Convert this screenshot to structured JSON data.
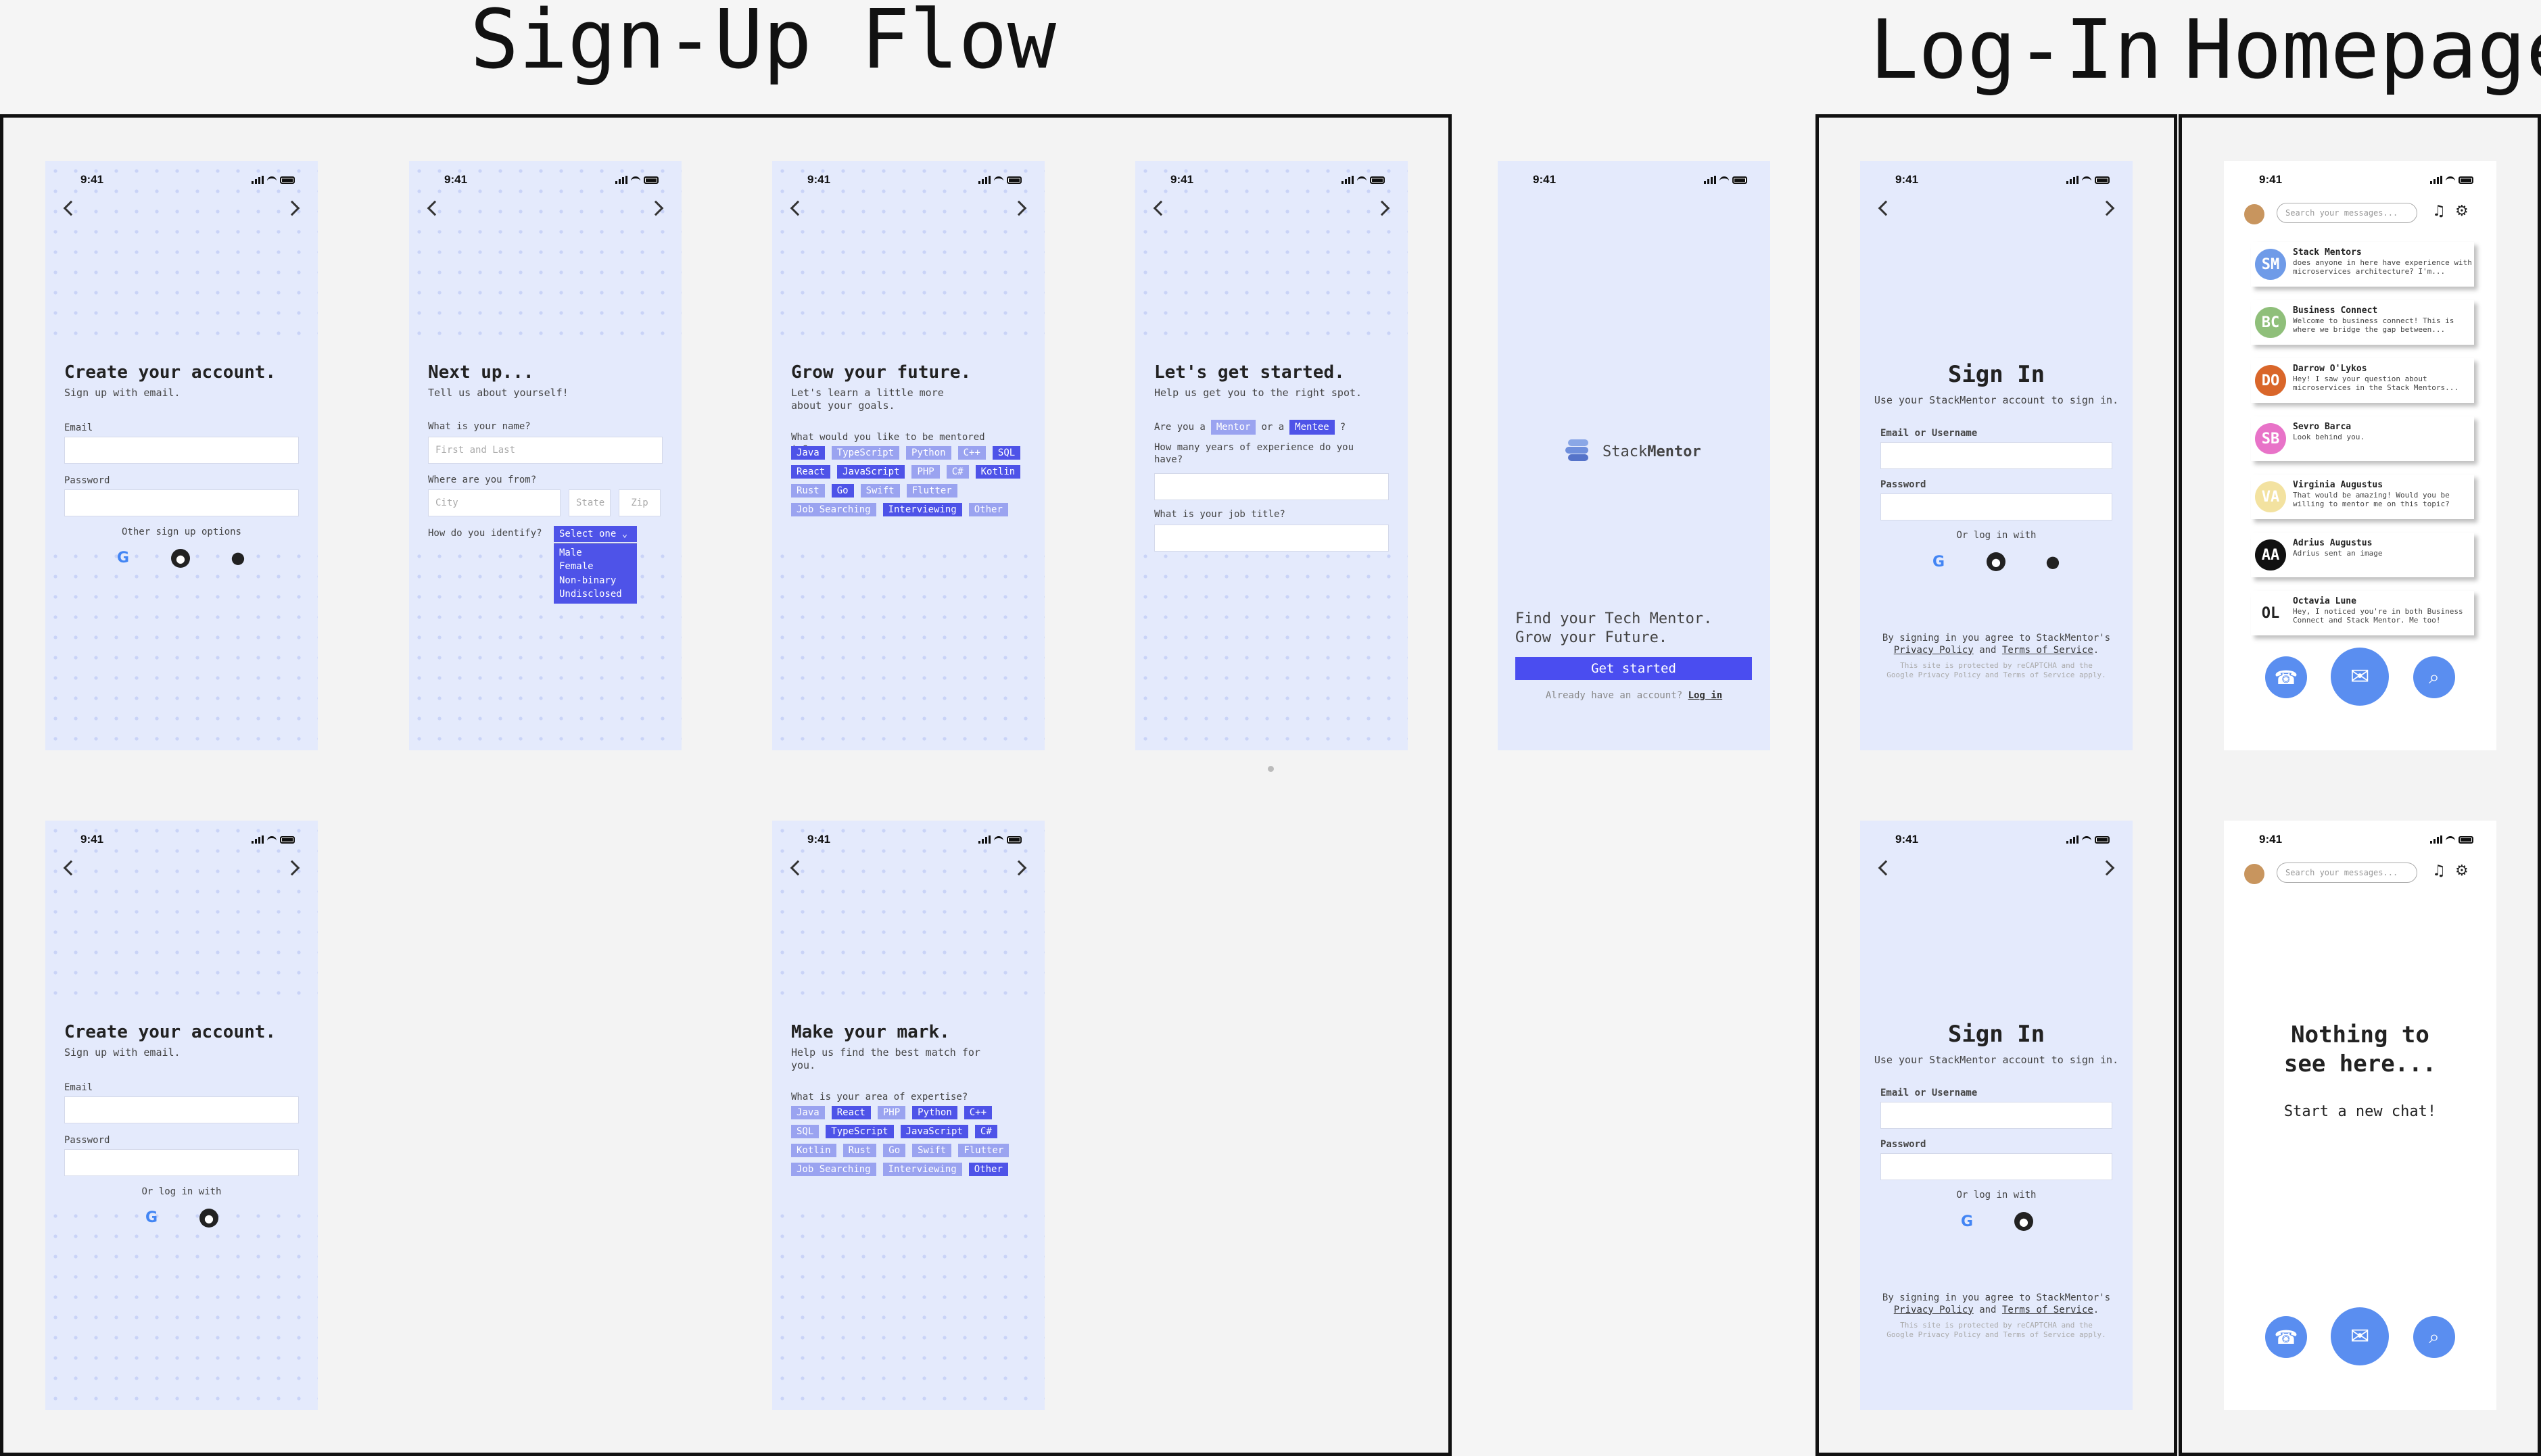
{
  "sections": {
    "signup": "Sign-Up Flow",
    "login": "Log-In",
    "home": "Homepage"
  },
  "status_time": "9:41",
  "create": {
    "title": "Create your account.",
    "subtitle": "Sign up with email.",
    "email": "Email",
    "password": "Password",
    "other": "Other sign up options",
    "or_login": "Or log in with"
  },
  "next": {
    "title": "Next up...",
    "subtitle": "Tell us about yourself!",
    "name_q": "What is your name?",
    "name_ph": "First and Last",
    "where_q": "Where are you from?",
    "city": "City",
    "state": "State",
    "zip": "Zip",
    "identify_q": "How do you identify?",
    "select": "Select one ⌄",
    "options": [
      "Male",
      "Female",
      "Non-binary",
      "Undisclosed"
    ]
  },
  "grow": {
    "title": "Grow your future.",
    "subtitle": "Let's learn a little more about your goals.",
    "q": "What would you like to be mentored in?",
    "chips": [
      {
        "label": "Java",
        "on": true
      },
      {
        "label": "TypeScript",
        "on": false
      },
      {
        "label": "Python",
        "on": false
      },
      {
        "label": "C++",
        "on": false
      },
      {
        "label": "SQL",
        "on": true
      },
      {
        "label": "React",
        "on": true
      },
      {
        "label": "JavaScript",
        "on": true
      },
      {
        "label": "PHP",
        "on": false
      },
      {
        "label": "C#",
        "on": false
      },
      {
        "label": "Kotlin",
        "on": true
      },
      {
        "label": "Rust",
        "on": false
      },
      {
        "label": "Go",
        "on": true
      },
      {
        "label": "Swift",
        "on": false
      },
      {
        "label": "Flutter",
        "on": false
      },
      {
        "label": "Job Searching",
        "on": false
      },
      {
        "label": "Interviewing",
        "on": true
      },
      {
        "label": "Other",
        "on": false
      }
    ]
  },
  "started": {
    "title": "Let's get started.",
    "subtitle": "Help us get you to the right spot.",
    "are_you": "Are you a",
    "mentor": "Mentor",
    "or_a": "or a",
    "mentee": "Mentee",
    "qmark": "?",
    "years_q": "How many years of experience do you have?",
    "job_q": "What is your job title?"
  },
  "mark": {
    "title": "Make your mark.",
    "subtitle": "Help us find the best match for you.",
    "q": "What is your area of expertise?",
    "chips": [
      {
        "label": "Java",
        "on": false
      },
      {
        "label": "React",
        "on": true
      },
      {
        "label": "PHP",
        "on": false
      },
      {
        "label": "Python",
        "on": true
      },
      {
        "label": "C++",
        "on": true
      },
      {
        "label": "SQL",
        "on": false
      },
      {
        "label": "TypeScript",
        "on": true
      },
      {
        "label": "JavaScript",
        "on": true
      },
      {
        "label": "C#",
        "on": true
      },
      {
        "label": "Kotlin",
        "on": false
      },
      {
        "label": "Rust",
        "on": false
      },
      {
        "label": "Go",
        "on": false
      },
      {
        "label": "Swift",
        "on": false
      },
      {
        "label": "Flutter",
        "on": false
      },
      {
        "label": "Job Searching",
        "on": false
      },
      {
        "label": "Interviewing",
        "on": false
      },
      {
        "label": "Other",
        "on": true
      }
    ]
  },
  "splash": {
    "brand_a": "Stack",
    "brand_b": "Mentor",
    "tagline1": "Find your Tech Mentor.",
    "tagline2": "Grow your Future.",
    "cta": "Get started",
    "have_account": "Already have an account?",
    "login": "Log in"
  },
  "signin": {
    "title": "Sign In",
    "subtitle": "Use your StackMentor account to sign in.",
    "user": "Email  or Username",
    "password": "Password",
    "or_login": "Or log in with",
    "agree1": "By signing in you agree to StackMentor's",
    "privacy": "Privacy Policy",
    "and": "and",
    "terms": "Terms of Service",
    "recaptcha1": "This site is protected by reCAPTCHA and the",
    "recaptcha2": "Google Privacy Policy and Terms of Service apply."
  },
  "home": {
    "search_ph": "Search your messages...",
    "empty_title1": "Nothing to",
    "empty_title2": "see here...",
    "empty_sub": "Start a new chat!",
    "chats": [
      {
        "initials": "SM",
        "name": "Stack Mentors",
        "preview": "does anyone in here have experience with microservices architecture? I'm...",
        "color": "#6f9be8"
      },
      {
        "initials": "BC",
        "name": "Business Connect",
        "preview": "Welcome to business connect! This is where we bridge the gap between...",
        "color": "#8fbf7a"
      },
      {
        "initials": "DO",
        "name": "Darrow O'Lykos",
        "preview": "Hey! I saw your question about microservices in the Stack Mentors...",
        "color": "#d9662a"
      },
      {
        "initials": "SB",
        "name": "Sevro Barca",
        "preview": "Look behind you.",
        "color": "#e873c8"
      },
      {
        "initials": "VA",
        "name": "Virginia Augustus",
        "preview": "That would be amazing! Would you be willing to mentor me on this topic?",
        "color": "#f3e2a0"
      },
      {
        "initials": "AA",
        "name": "Adrius Augustus",
        "preview": "Adrius sent an image",
        "color": "#111111"
      },
      {
        "initials": "OL",
        "name": "Octavia Lune",
        "preview": "Hey, I noticed you're in both Business Connect and Stack Mentor. Me too!",
        "color": "#ffffff"
      }
    ]
  }
}
